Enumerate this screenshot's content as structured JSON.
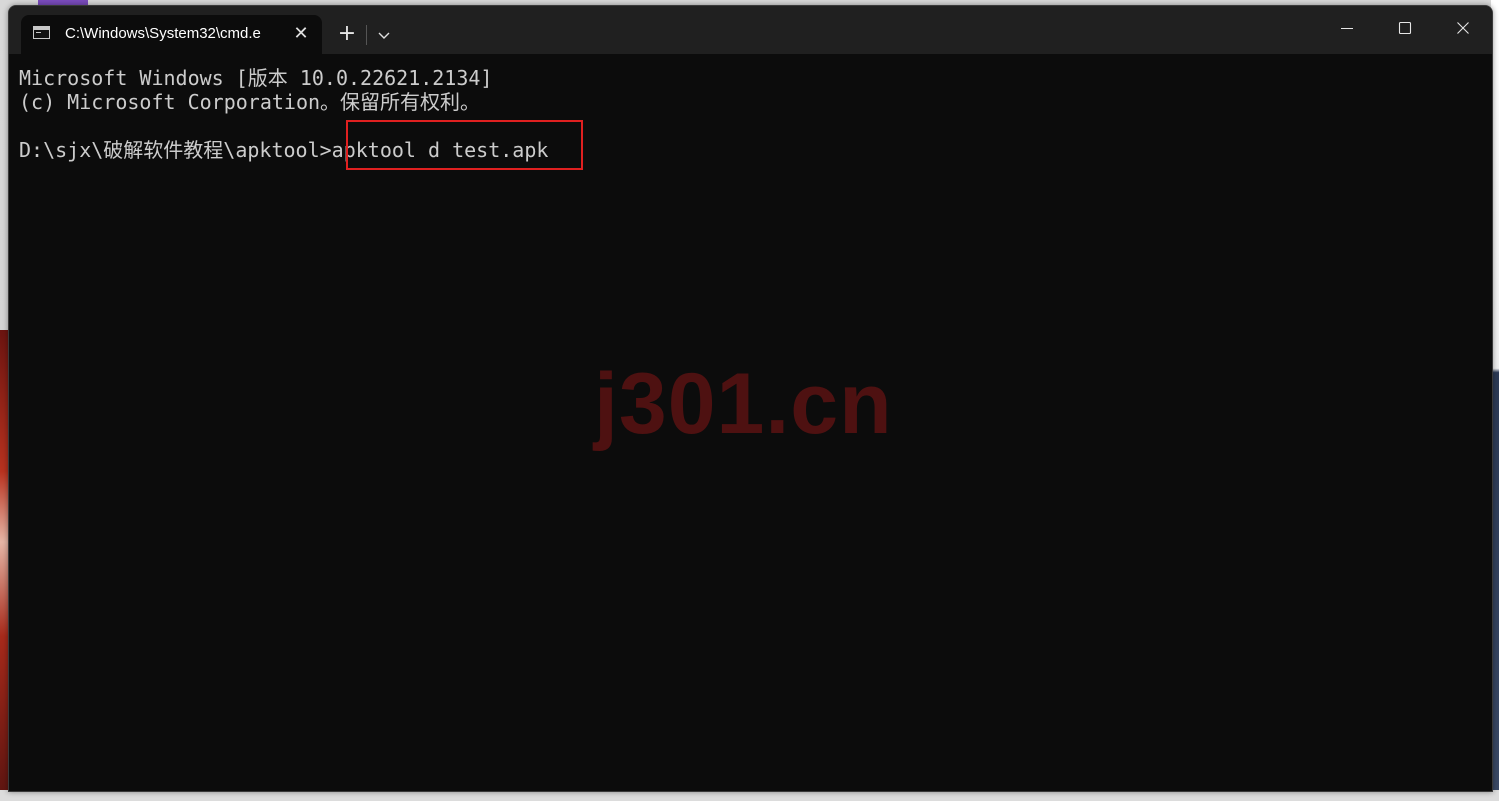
{
  "window": {
    "tab_title": "C:\\Windows\\System32\\cmd.e",
    "tab_close_glyph": "✕",
    "new_tab_glyph": "+",
    "icons": [
      "cmd-icon",
      "close-icon",
      "plus-icon",
      "chevron-down-icon",
      "minimize-icon",
      "maximize-icon",
      "close-window-icon"
    ]
  },
  "console": {
    "line1": "Microsoft Windows [版本 10.0.22621.2134]",
    "line2": "(c) Microsoft Corporation。保留所有权利。",
    "prompt": "D:\\sjx\\破解软件教程\\apktool>",
    "command": "apktool d test.apk"
  },
  "overlay": {
    "watermark": "j301.cn",
    "highlight_color": "#e02020"
  },
  "colors": {
    "console_bg": "#0c0c0c",
    "console_text": "#cccccc",
    "titlebar_bg": "#202020"
  }
}
